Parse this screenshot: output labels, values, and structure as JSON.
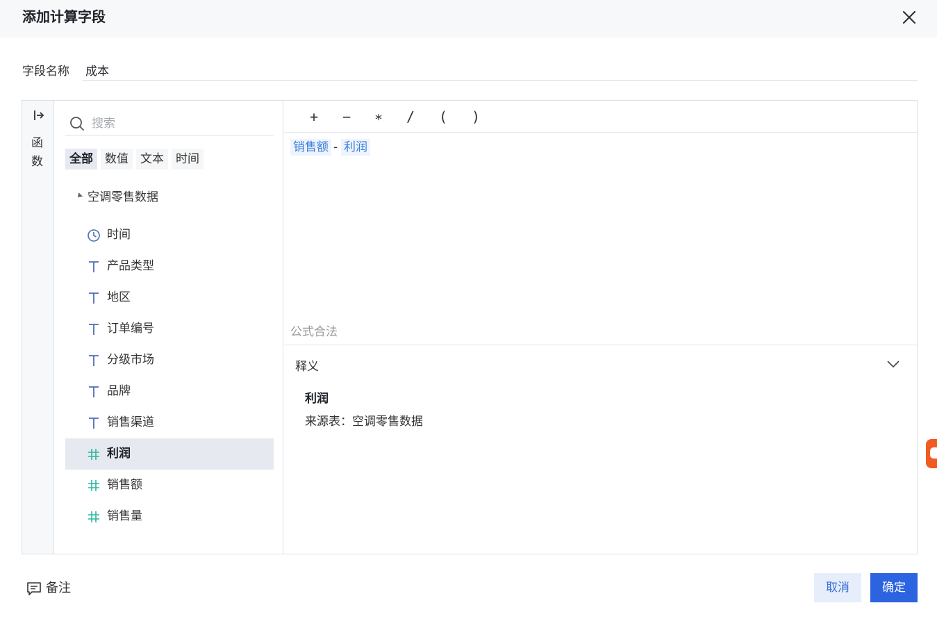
{
  "dialog": {
    "title": "添加计算字段"
  },
  "name_field": {
    "label": "字段名称",
    "value": "成本"
  },
  "functions_rail": {
    "label": "函数"
  },
  "field_panel": {
    "search_placeholder": "搜索",
    "filter_tabs": [
      {
        "label": "全部",
        "active": true
      },
      {
        "label": "数值",
        "active": false
      },
      {
        "label": "文本",
        "active": false
      },
      {
        "label": "时间",
        "active": false
      }
    ],
    "group_label": "空调零售数据",
    "fields": [
      {
        "label": "时间",
        "icon": "clock-icon",
        "selected": false
      },
      {
        "label": "产品类型",
        "icon": "text-type-icon",
        "selected": false
      },
      {
        "label": "地区",
        "icon": "text-type-icon",
        "selected": false
      },
      {
        "label": "订单编号",
        "icon": "text-type-icon",
        "selected": false
      },
      {
        "label": "分级市场",
        "icon": "text-type-icon",
        "selected": false
      },
      {
        "label": "品牌",
        "icon": "text-type-icon",
        "selected": false
      },
      {
        "label": "销售渠道",
        "icon": "text-type-icon",
        "selected": false
      },
      {
        "label": "利润",
        "icon": "number-type-icon",
        "selected": true
      },
      {
        "label": "销售额",
        "icon": "number-type-icon",
        "selected": false
      },
      {
        "label": "销售量",
        "icon": "number-type-icon",
        "selected": false
      }
    ]
  },
  "editor": {
    "operators": [
      "+",
      "−",
      "∗",
      "/",
      "(",
      ")"
    ],
    "formula": {
      "token1": "销售额",
      "operator": "-",
      "token2": "利润"
    },
    "status": "公式合法"
  },
  "description": {
    "title": "释义",
    "field_name": "利润",
    "source": "来源表：空调零售数据"
  },
  "footer": {
    "note_label": "备注",
    "cancel_label": "取消",
    "ok_label": "确定"
  },
  "colors": {
    "primary": "#2b63e0",
    "token_bg": "#eef4ff",
    "token_text": "#3a7bd5",
    "number_icon": "#2bb5a0",
    "text_icon": "#4a6fb5",
    "badge": "#f15a22"
  }
}
